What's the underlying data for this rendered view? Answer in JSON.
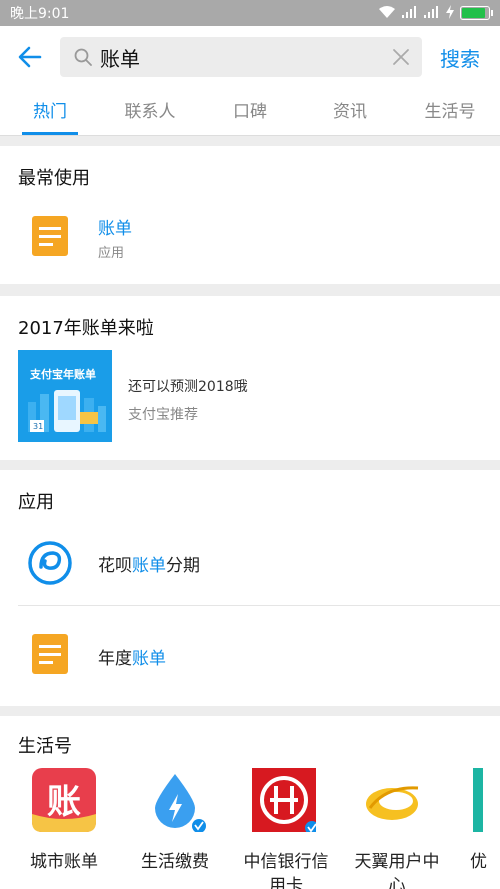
{
  "status_bar": {
    "time": "晚上9:01"
  },
  "search": {
    "query": "账单",
    "button_label": "搜索"
  },
  "tabs": [
    {
      "label": "热门"
    },
    {
      "label": "联系人"
    },
    {
      "label": "口碑"
    },
    {
      "label": "资讯"
    },
    {
      "label": "生活号"
    }
  ],
  "most_used": {
    "title": "最常使用",
    "item": {
      "name": "账单",
      "type": "应用"
    }
  },
  "promo": {
    "title": "2017年账单来啦",
    "thumb_text": "支付宝年账单",
    "thumb_date": "31",
    "desc": "还可以预测2018哦",
    "source": "支付宝推荐"
  },
  "apps": {
    "title": "应用",
    "items": [
      {
        "prefix": "花呗",
        "highlight": "账单",
        "suffix": "分期"
      },
      {
        "prefix": "年度",
        "highlight": "账单",
        "suffix": ""
      }
    ]
  },
  "life": {
    "title": "生活号",
    "items": [
      {
        "name": "城市账单",
        "icon_text": "账"
      },
      {
        "name": "生活缴费"
      },
      {
        "name": "中信银行信用卡"
      },
      {
        "name": "天翼用户中心"
      },
      {
        "name": "优"
      }
    ]
  },
  "colors": {
    "accent": "#108ee9",
    "orange": "#f5a623"
  }
}
